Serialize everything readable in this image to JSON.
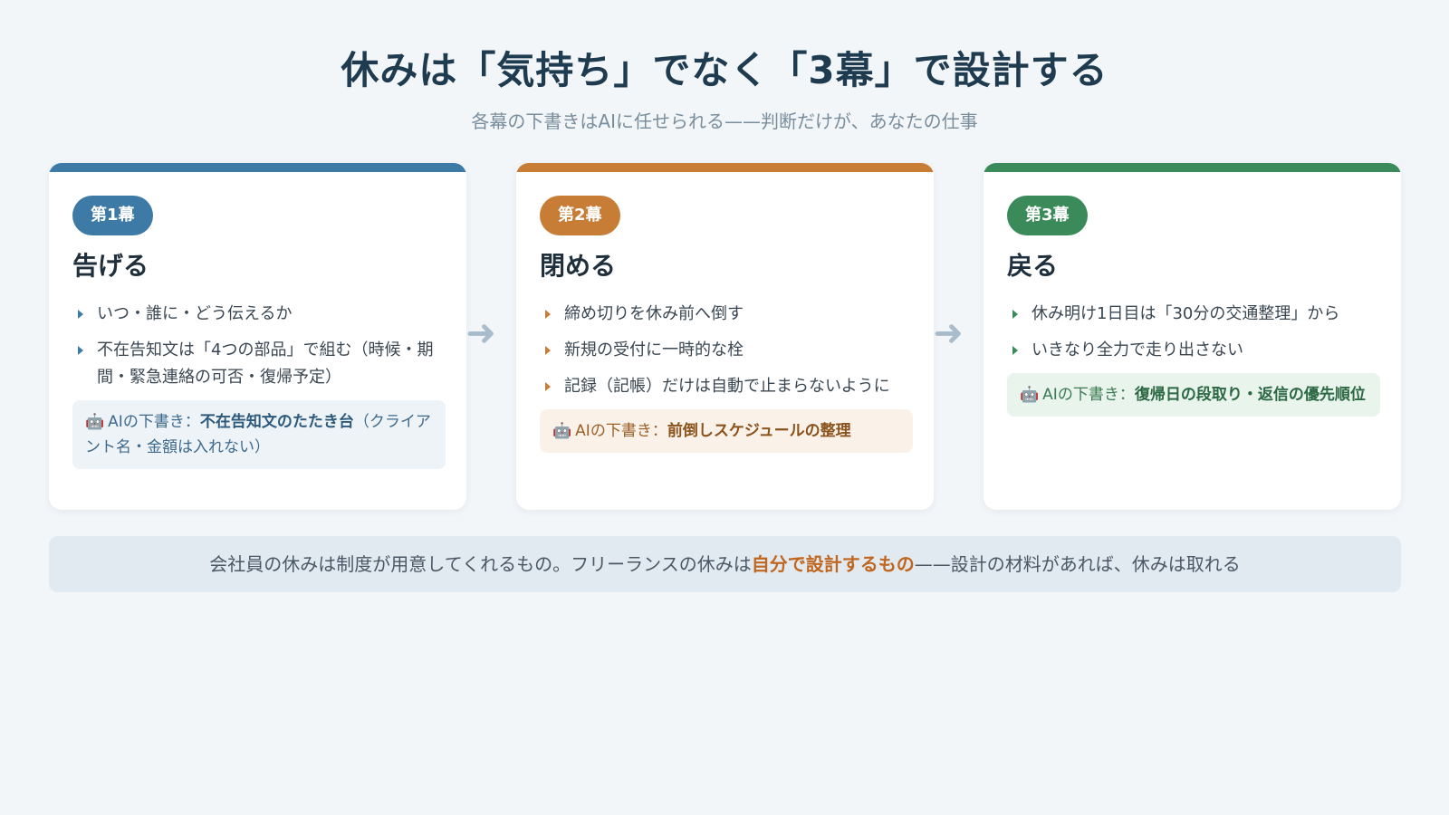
{
  "header": {
    "title": "休みは「気持ち」でなく「3幕」で設計する",
    "subtitle": "各幕の下書きはAIに任せられる——判断だけが、あなたの仕事"
  },
  "colors": {
    "act1": "#3d7ba6",
    "act2": "#c87d36",
    "act3": "#3b8a5a",
    "act1_box_bg": "#eef3f7",
    "act2_box_bg": "#faf2e8",
    "act3_box_bg": "#e8f4ec",
    "highlight": "#c0661e"
  },
  "acts": [
    {
      "badge": "第1幕",
      "title": "告げる",
      "points": [
        "いつ・誰に・どう伝えるか",
        "不在告知文は「4つの部品」で組む（時候・期間・緊急連絡の可否・復帰予定）"
      ],
      "ai": {
        "icon": "robot-icon",
        "prefix": "AIの下書き：",
        "strong": "不在告知文のたたき台",
        "suffix": "（クライアント名・金額は入れない）"
      }
    },
    {
      "badge": "第2幕",
      "title": "閉める",
      "points": [
        "締め切りを休み前へ倒す",
        "新規の受付に一時的な栓",
        "記録（記帳）だけは自動で止まらないように"
      ],
      "ai": {
        "icon": "robot-icon",
        "prefix": "AIの下書き：",
        "strong": "前倒しスケジュールの整理",
        "suffix": ""
      }
    },
    {
      "badge": "第3幕",
      "title": "戻る",
      "points": [
        "休み明け1日目は「30分の交通整理」から",
        "いきなり全力で走り出さない"
      ],
      "ai": {
        "icon": "robot-icon",
        "prefix": "AIの下書き：",
        "strong": "復帰日の段取り・返信の優先順位",
        "suffix": ""
      }
    }
  ],
  "arrows": [
    "➜",
    "➜"
  ],
  "footer": {
    "before": "会社員の休みは制度が用意してくれるもの。フリーランスの休みは",
    "highlight": "自分で設計するもの",
    "after": "——設計の材料があれば、休みは取れる"
  }
}
